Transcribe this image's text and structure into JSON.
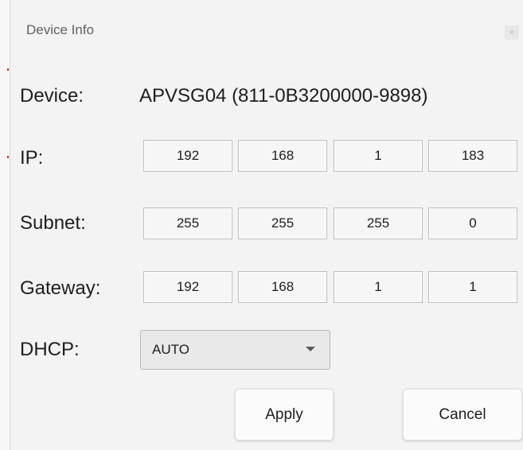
{
  "dialog": {
    "title": "Device Info",
    "close_glyph": "×"
  },
  "device": {
    "label": "Device:",
    "value": "APVSG04 (811-0B3200000-9898)"
  },
  "ip": {
    "label": "IP:",
    "octets": [
      "192",
      "168",
      "1",
      "183"
    ]
  },
  "subnet": {
    "label": "Subnet:",
    "octets": [
      "255",
      "255",
      "255",
      "0"
    ]
  },
  "gateway": {
    "label": "Gateway:",
    "octets": [
      "192",
      "168",
      "1",
      "1"
    ]
  },
  "dhcp": {
    "label": "DHCP:",
    "selected": "AUTO"
  },
  "buttons": {
    "apply": "Apply",
    "cancel": "Cancel"
  }
}
